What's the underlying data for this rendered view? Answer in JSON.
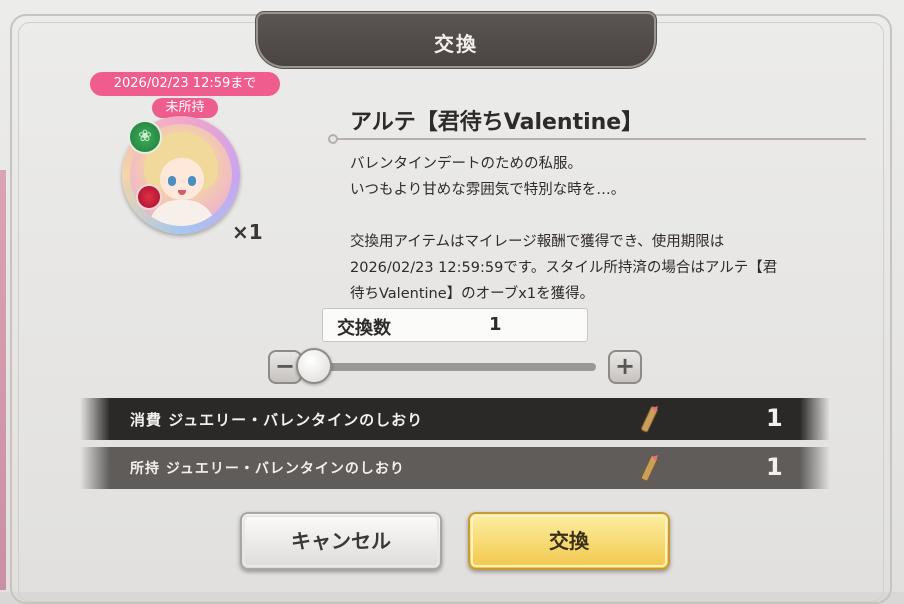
{
  "dialog": {
    "title": "交換"
  },
  "item": {
    "deadline_badge": "2026/02/23 12:59まで",
    "owned_badge": "未所持",
    "quantity": "×1",
    "name": "アルテ【君待ちValentine】",
    "description_lines": [
      "バレンタインデートのための私服。",
      "いつもより甘めな雰囲気で特別な時を…。",
      "交換用アイテムはマイレージ報酬で獲得でき、使用期限は",
      "2026/02/23 12:59:59です。スタイル所持済の場合はアルテ【君",
      "待ちValentine】のオーブx1を獲得。"
    ]
  },
  "exchange": {
    "count_label": "交換数",
    "count_value": "1",
    "minus_label": "−",
    "plus_label": "+",
    "slider_fraction": 0.0
  },
  "cost_rows": {
    "consume": {
      "label": "消費 ジュエリー・バレンタインのしおり",
      "value": "1",
      "icon": "bookmark-icon"
    },
    "owned": {
      "label": "所持 ジュエリー・バレンタインのしおり",
      "value": "1",
      "icon": "bookmark-icon"
    }
  },
  "buttons": {
    "cancel": "キャンセル",
    "exchange": "交換"
  },
  "colors": {
    "badge": "#ef5d8e",
    "confirm": "#f2c74c",
    "banner": "#4f4947"
  }
}
